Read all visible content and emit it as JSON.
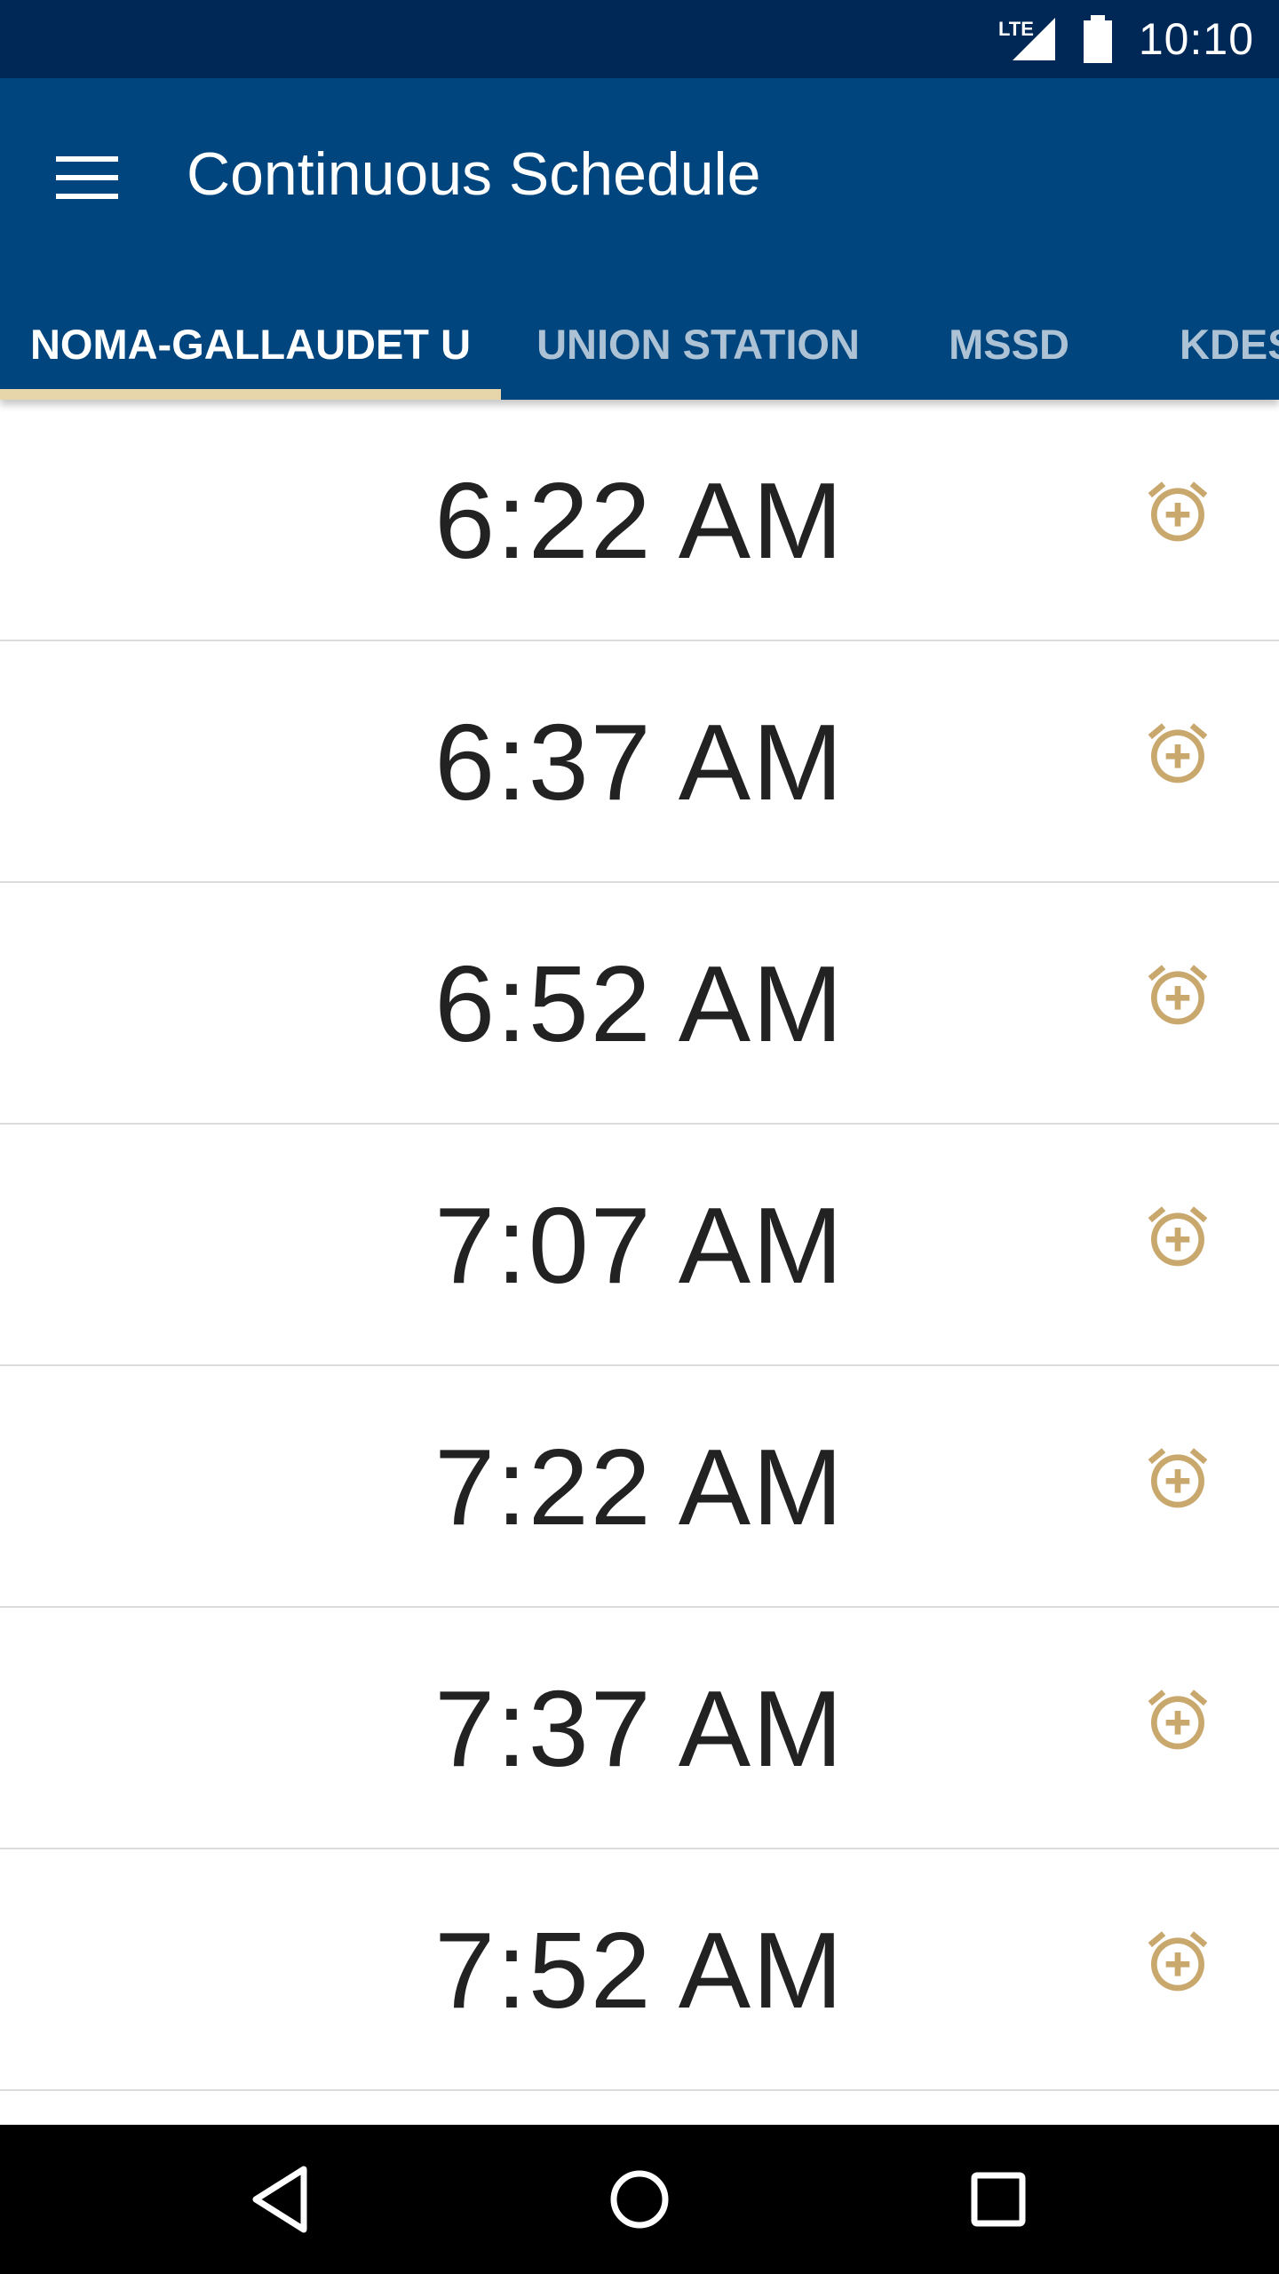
{
  "status_bar": {
    "network": "LTE",
    "time": "10:10"
  },
  "header": {
    "title": "Continuous Schedule",
    "menu_icon": "hamburger-menu-icon"
  },
  "tabs": [
    {
      "label": "NOMA-GALLAUDET U",
      "active": true
    },
    {
      "label": "UNION STATION",
      "active": false
    },
    {
      "label": "MSSD",
      "active": false
    },
    {
      "label": "KDES",
      "active": false
    }
  ],
  "schedule": {
    "times": [
      "6:22 AM",
      "6:37 AM",
      "6:52 AM",
      "7:07 AM",
      "7:22 AM",
      "7:37 AM",
      "7:52 AM"
    ],
    "row_icon": "add-alarm-icon"
  },
  "colors": {
    "status_bar": "#002856",
    "app_bar": "#00457d",
    "tab_indicator": "#e8d6ab",
    "alarm_icon": "#c9a86e"
  },
  "navigation": {
    "back_icon": "back-icon",
    "home_icon": "home-icon",
    "recents_icon": "recents-icon"
  }
}
